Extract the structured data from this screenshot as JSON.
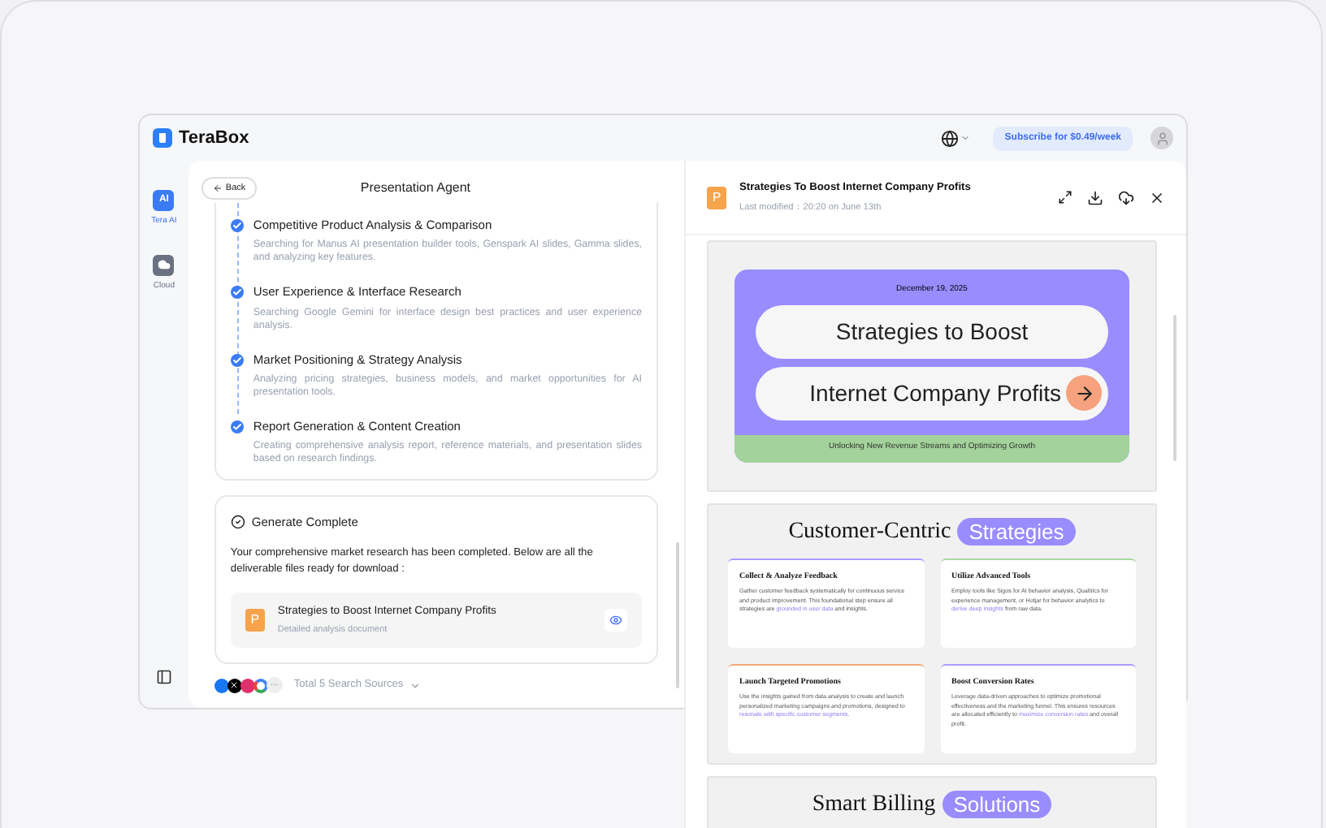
{
  "app": {
    "name": "TeraBox"
  },
  "top_bar": {
    "subscribe": "Subscribe for $0.49/week"
  },
  "sidebar": {
    "items": [
      {
        "kind": "ai",
        "icon_text": "AI",
        "label": "Tera AI",
        "selected": true
      },
      {
        "kind": "cloud",
        "label": "Cloud",
        "selected": false
      }
    ]
  },
  "agent": {
    "back": "Back",
    "title": "Presentation Agent",
    "steps": [
      {
        "title": "Competitive Product Analysis & Comparison",
        "description": "Searching for Manus AI presentation builder tools, Genspark AI slides, Gamma slides, and analyzing key features.",
        "done": true
      },
      {
        "title": "User Experience & Interface Research",
        "description": "Searching Google Gemini for interface design best practices and user experience analysis.",
        "done": true
      },
      {
        "title": "Market Positioning & Strategy Analysis",
        "description": "Analyzing pricing strategies, business models, and market opportunities for AI presentation tools.",
        "done": true
      },
      {
        "title": "Report Generation & Content Creation",
        "description": "Creating comprehensive analysis report, reference materials, and presentation slides based on research findings.",
        "done": true
      }
    ],
    "complete": {
      "title": "Generate Complete",
      "message": "Your comprehensive market research has been completed. Below are all the deliverable files ready for download :",
      "file": {
        "icon_text": "P",
        "name": "Strategies to Boost Internet Company Profits",
        "subtitle": "Detailed analysis document"
      }
    },
    "sources": {
      "more": "···",
      "label": "Total 5 Search Sources"
    }
  },
  "preview": {
    "icon_text": "P",
    "title": "Strategies To Boost Internet Company Profits",
    "modified": "Last modified：20:20 on June 13th",
    "slides": [
      {
        "kind": "title",
        "date": "December 19, 2025",
        "line_1": "Strategies to Boost",
        "line_2": "Internet Company Profits",
        "footer": "Unlocking New Revenue Streams and Optimizing Growth"
      },
      {
        "kind": "cards",
        "title": "Customer-Centric",
        "highlight": "Strategies",
        "cards": [
          {
            "title": "Collect & Analyze Feedback",
            "color": "#a89bff",
            "text": "Gather customer feedback systematically for continuous service and product improvement. This foundational step ensure all strategies are ",
            "link": "grounded in user data",
            "after": " and insights."
          },
          {
            "title": "Utilize Advanced Tools",
            "color": "#a8d9a0",
            "text": "Employ tools like Sigos for AI behavior analysis, Qualtrics for experience management, or Hotjar for behavior analytics to ",
            "link": "derive deep insights",
            "after": " from raw data."
          },
          {
            "title": "Launch Targeted Promotions",
            "color": "#f4a97c",
            "text": "Use the insights gained from data analysis to create and launch personalized marketing campaigns and promotions, designed to ",
            "link": "resonate with specific customer segments",
            "after": "."
          },
          {
            "title": "Boost Conversion Rates",
            "color": "#a89bff",
            "text": "Leverage data-driven approaches to optimize promotional effectiveness and the marketing funnel. This ensures resources are allocated efficiently to ",
            "link": "maximize conversion rates",
            "after": " and overall profit."
          }
        ]
      },
      {
        "kind": "cards",
        "title": "Smart Billing",
        "highlight": "Solutions"
      }
    ]
  }
}
